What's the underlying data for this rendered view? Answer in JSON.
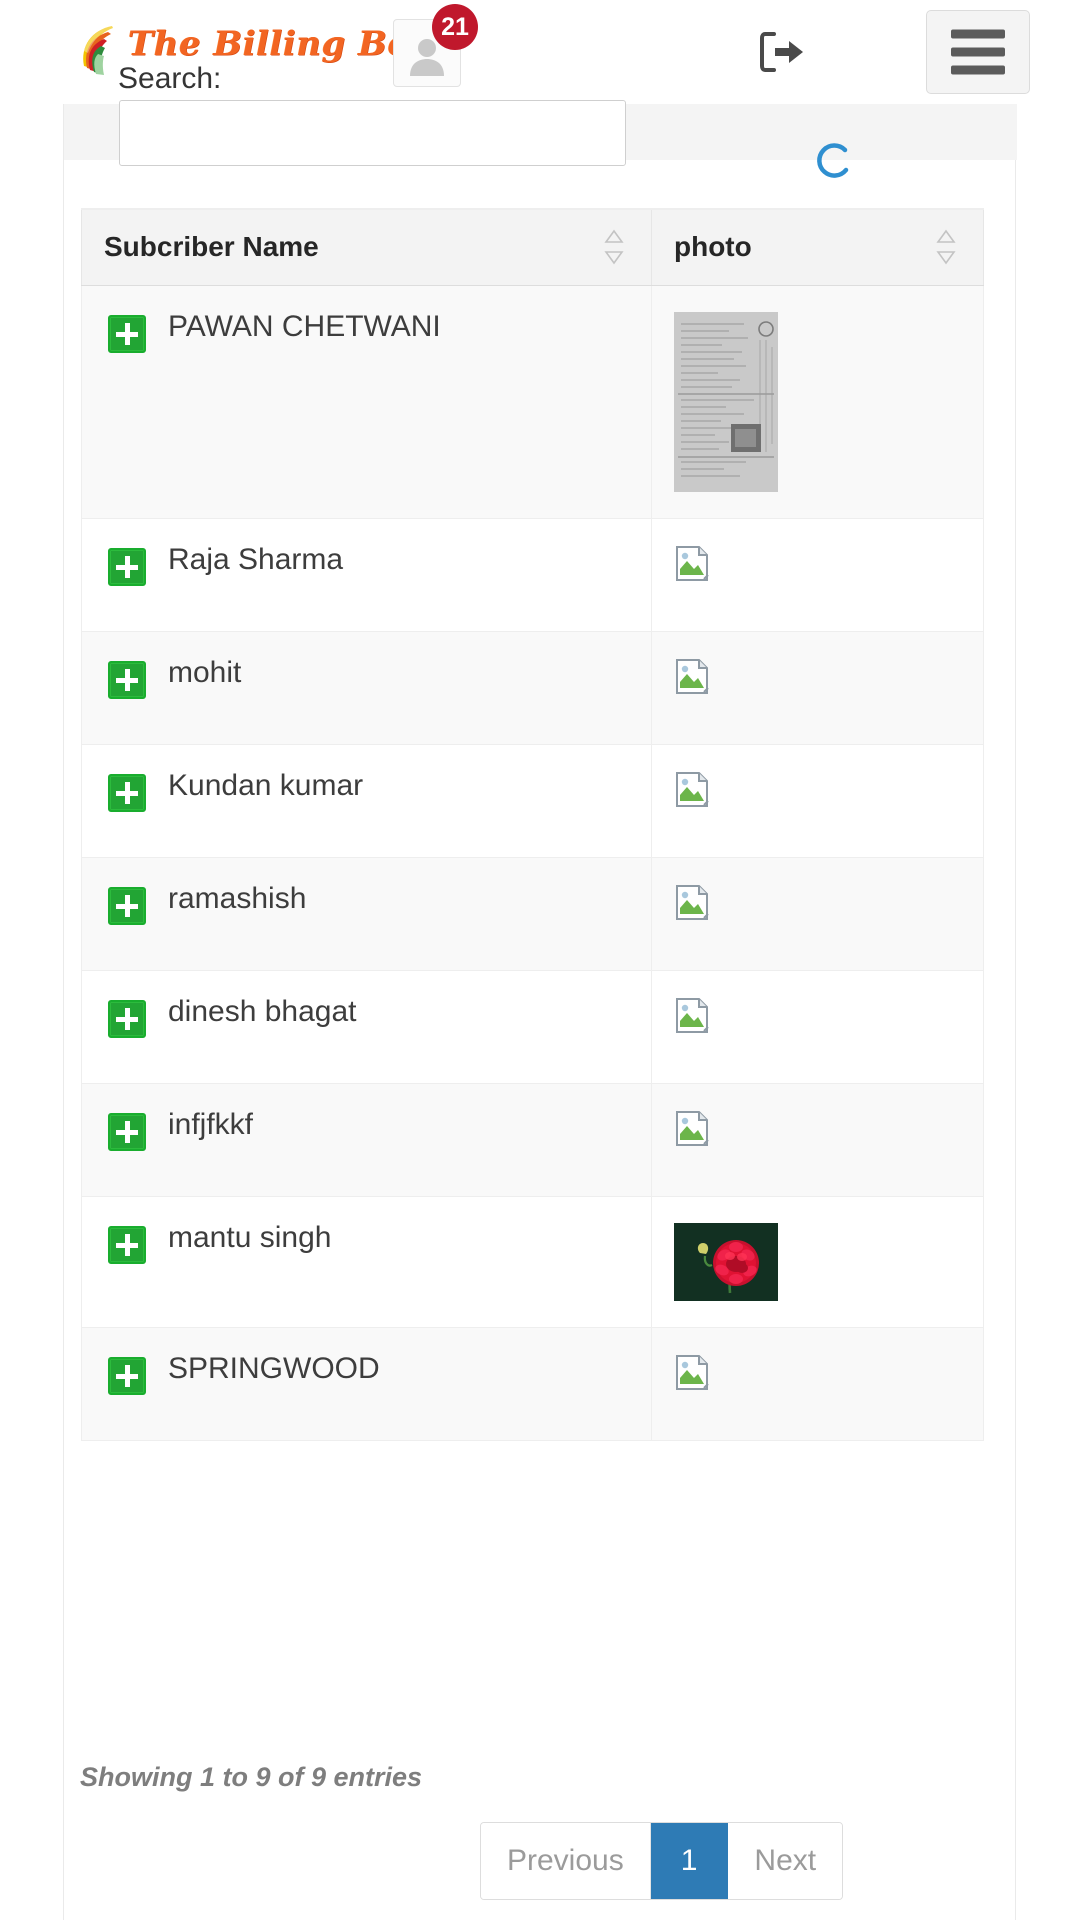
{
  "header": {
    "logo_text": "The Billing Book",
    "logo_icon": "rainbow-swoosh-icon",
    "avatar_icon": "user-avatar-icon",
    "notification_count": "21",
    "logout_icon": "sign-out-icon",
    "menu_icon": "hamburger-menu-icon"
  },
  "status": {
    "spinner_icon": "loading-spinner-icon"
  },
  "search": {
    "label": "Search:",
    "value": "",
    "placeholder": ""
  },
  "table": {
    "columns": [
      {
        "label": "Subcriber Name",
        "sort_icon": "sort-arrows-icon"
      },
      {
        "label": "photo",
        "sort_icon": "sort-arrows-icon"
      }
    ],
    "rows": [
      {
        "expand_icon": "plus-icon",
        "name": "PAWAN CHETWANI",
        "photo_type": "document-scan-thumbnail"
      },
      {
        "expand_icon": "plus-icon",
        "name": "Raja Sharma",
        "photo_type": "broken-image-icon"
      },
      {
        "expand_icon": "plus-icon",
        "name": "mohit",
        "photo_type": "broken-image-icon"
      },
      {
        "expand_icon": "plus-icon",
        "name": "Kundan kumar",
        "photo_type": "broken-image-icon"
      },
      {
        "expand_icon": "plus-icon",
        "name": "ramashish",
        "photo_type": "broken-image-icon"
      },
      {
        "expand_icon": "plus-icon",
        "name": "dinesh bhagat",
        "photo_type": "broken-image-icon"
      },
      {
        "expand_icon": "plus-icon",
        "name": "infjfkkf",
        "photo_type": "broken-image-icon"
      },
      {
        "expand_icon": "plus-icon",
        "name": "mantu singh",
        "photo_type": "flower-thumbnail"
      },
      {
        "expand_icon": "plus-icon",
        "name": "SPRINGWOOD",
        "photo_type": "broken-image-icon"
      }
    ]
  },
  "footer": {
    "info": "Showing 1 to 9 of 9 entries",
    "pagination": {
      "previous_label": "Previous",
      "next_label": "Next",
      "pages": [
        "1"
      ],
      "active_page": "1"
    }
  },
  "colors": {
    "logo_orange": "#f26522",
    "badge_red": "#c0182c",
    "plus_green": "#22a534",
    "pagination_active_blue": "#2e7bb5",
    "spinner_blue": "#2f8fd0"
  }
}
